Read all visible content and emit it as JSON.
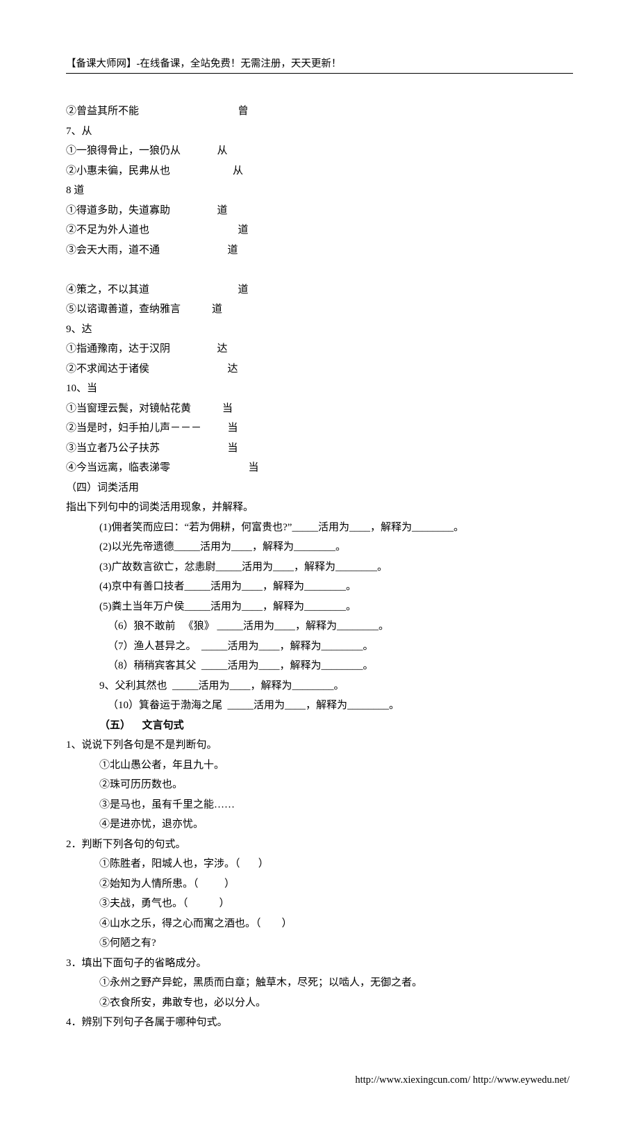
{
  "header": "【备课大师网】-在线备课，全站免费！无需注册，天天更新！",
  "footer": "http://www.xiexingcun.com/ http://www.eywedu.net/",
  "lines": [
    {
      "cls": "",
      "t": "②曾益其所不能                                      曾"
    },
    {
      "cls": "",
      "t": "7、从"
    },
    {
      "cls": "",
      "t": "①一狼得骨止，一狼仍从              从"
    },
    {
      "cls": "",
      "t": "②小惠未徧，民弗从也                        从"
    },
    {
      "cls": "",
      "t": "8 道"
    },
    {
      "cls": "",
      "t": "①得道多助，失道寡助                  道"
    },
    {
      "cls": "",
      "t": "②不足为外人道也                                  道"
    },
    {
      "cls": "",
      "t": "③会天大雨，道不通                          道"
    },
    {
      "cls": "",
      "t": " "
    },
    {
      "cls": "",
      "t": "④策之，不以其道                                  道"
    },
    {
      "cls": "",
      "t": "⑤以谘诹善道，查纳雅言            道"
    },
    {
      "cls": "",
      "t": "9、达"
    },
    {
      "cls": "",
      "t": "①指通豫南，达于汉阴                  达"
    },
    {
      "cls": "",
      "t": "②不求闻达于诸侯                              达"
    },
    {
      "cls": "",
      "t": "10、当"
    },
    {
      "cls": "",
      "t": "①当窗理云鬓，对镜帖花黄            当"
    },
    {
      "cls": "",
      "t": "②当是时，妇手拍儿声－－－          当"
    },
    {
      "cls": "",
      "t": "③当立者乃公子扶苏                          当"
    },
    {
      "cls": "",
      "t": "④今当远离，临表涕零                              当"
    },
    {
      "cls": "",
      "t": "（四）词类活用"
    },
    {
      "cls": "",
      "t": "指出下列句中的词类活用现象，并解释。"
    },
    {
      "cls": "indent1",
      "t": "(1)佣者笑而应曰：“若为佣耕，何富贵也?”_____活用为____，解释为________。"
    },
    {
      "cls": "indent1",
      "t": "(2)以光先帝遗德_____活用为____，解释为________。"
    },
    {
      "cls": "indent1",
      "t": "(3)广故数言欲亡，忿恚尉_____活用为____，解释为________。"
    },
    {
      "cls": "indent1",
      "t": "(4)京中有善口技者_____活用为____，解释为________。"
    },
    {
      "cls": "indent1",
      "t": "(5)粪土当年万户侯_____活用为____，解释为________。"
    },
    {
      "cls": "indent2",
      "t": "（6）狼不敢前   《狼》 _____活用为____，解释为________。"
    },
    {
      "cls": "indent2",
      "t": "（7）渔人甚异之。  _____活用为____，解释为________。"
    },
    {
      "cls": "indent2",
      "t": "（8）稍稍宾客其父  _____活用为____，解释为________。"
    },
    {
      "cls": "indent1",
      "t": "9、父利其然也  _____活用为____，解释为________。"
    },
    {
      "cls": "indent2",
      "t": "（10）箕畚运于渤海之尾  _____活用为____，解释为________。"
    },
    {
      "cls": "indent1 bold",
      "t": "（五）    文言句式"
    },
    {
      "cls": "",
      "t": "1、说说下列各句是不是判断句。"
    },
    {
      "cls": "indent1",
      "t": "①北山愚公者，年且九十。"
    },
    {
      "cls": "indent1",
      "t": "②珠可历历数也。"
    },
    {
      "cls": "indent1",
      "t": "③是马也，虽有千里之能……"
    },
    {
      "cls": "indent1",
      "t": "④是进亦忧，退亦忧。"
    },
    {
      "cls": "",
      "t": "2．判断下列各句的句式。"
    },
    {
      "cls": "indent1",
      "t": "①陈胜者，阳城人也，字涉。（       ）"
    },
    {
      "cls": "indent1",
      "t": "②始知为人情所患。（          ）"
    },
    {
      "cls": "indent1",
      "t": "③夫战，勇气也。（            ）"
    },
    {
      "cls": "indent1",
      "t": "④山水之乐，得之心而寓之酒也。（        ）"
    },
    {
      "cls": "indent1",
      "t": "⑤何陋之有?"
    },
    {
      "cls": "",
      "t": "3．填出下面句子的省略成分。"
    },
    {
      "cls": "indent1",
      "t": "①永州之野产异蛇，黑质而白章；触草木，尽死；以啮人，无御之者。"
    },
    {
      "cls": "indent1",
      "t": "②衣食所安，弗敢专也，必以分人。"
    },
    {
      "cls": "",
      "t": "4．辨别下列句子各属于哪种句式。"
    }
  ]
}
